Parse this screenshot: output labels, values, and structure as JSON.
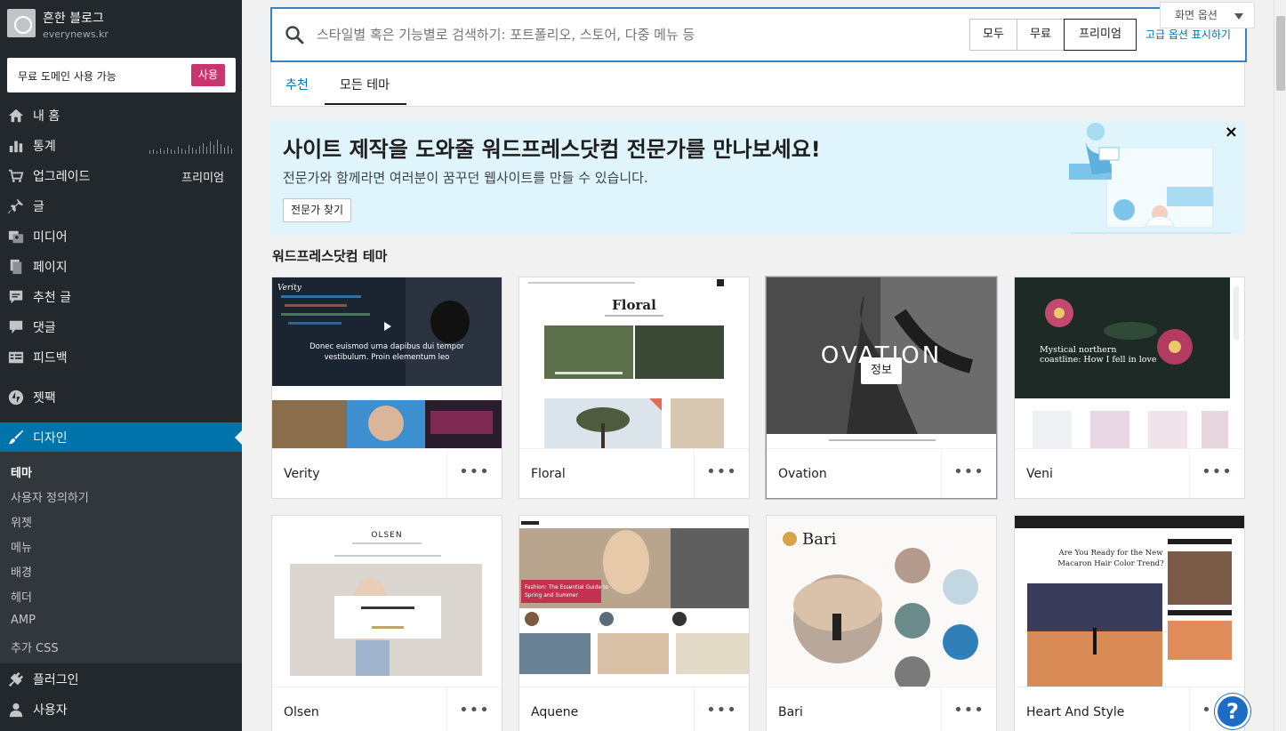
{
  "site": {
    "title": "흔한 블로그",
    "url": "everynews.kr"
  },
  "domain_promo": {
    "text": "무료 도메인 사용 가능",
    "button": "사용"
  },
  "nav": [
    {
      "label": "내 홈",
      "icon": "home-icon"
    },
    {
      "label": "통계",
      "icon": "stats-icon"
    },
    {
      "label": "업그레이드",
      "icon": "cart-icon",
      "extra": "프리미엄"
    },
    {
      "label": "글",
      "icon": "pin-icon"
    },
    {
      "label": "미디어",
      "icon": "media-icon"
    },
    {
      "label": "페이지",
      "icon": "pages-icon"
    },
    {
      "label": "추천 글",
      "icon": "feedback-icon"
    },
    {
      "label": "댓글",
      "icon": "comment-icon"
    },
    {
      "label": "피드백",
      "icon": "form-icon"
    },
    {
      "label": "젯팩",
      "icon": "jetpack-icon"
    },
    {
      "label": "디자인",
      "icon": "brush-icon"
    },
    {
      "label": "플러그인",
      "icon": "plugin-icon"
    },
    {
      "label": "사용자",
      "icon": "user-icon"
    }
  ],
  "submenu": [
    "테마",
    "사용자 정의하기",
    "위젯",
    "메뉴",
    "배경",
    "헤더",
    "AMP",
    "추가 CSS"
  ],
  "search": {
    "placeholder": "스타일별 혹은 기능별로 검색하기: 포트폴리오, 스토어, 다중 메뉴 등",
    "filters": [
      "모두",
      "무료",
      "프리미엄"
    ],
    "selected_filter": "프리미엄",
    "advanced": "고급 옵션 표시하기"
  },
  "screen_options": "화면 옵션",
  "tabs": [
    "추천",
    "모든 테마"
  ],
  "active_tab": "모든 테마",
  "banner": {
    "title": "사이트 제작을 도와줄 워드프레스닷컴 전문가를 만나보세요!",
    "description": "전문가와 함께라면 여러분이 꿈꾸던 웹사이트를 만들 수 있습니다.",
    "button": "전문가 찾기",
    "close": "×"
  },
  "section_title": "워드프레스닷컴 테마",
  "themes": [
    {
      "name": "Verity",
      "thumb_text": "Donec euismod urna dapibus dui tempor vestibulum. Proin elementum leo"
    },
    {
      "name": "Floral",
      "thumb_text": "Floral"
    },
    {
      "name": "Ovation",
      "thumb_text": "OVATION",
      "hover": "정보"
    },
    {
      "name": "Veni",
      "thumb_text": "Mystical northern coastline: How I fell in love"
    },
    {
      "name": "Olsen",
      "thumb_text": "OLSEN"
    },
    {
      "name": "Aquene",
      "thumb_text": "Fashion: The Essential Guide to Spring and Summer"
    },
    {
      "name": "Bari",
      "thumb_text": "Bari"
    },
    {
      "name": "Heart And Style",
      "thumb_text": "Are You Ready for the New Macaron Hair Color Trend?"
    }
  ],
  "more_label": "•••",
  "help": "?",
  "colors": {
    "sidebar": "#23282d",
    "accent": "#0073aa",
    "promo": "#c9356e",
    "banner": "#e0f4fc"
  }
}
